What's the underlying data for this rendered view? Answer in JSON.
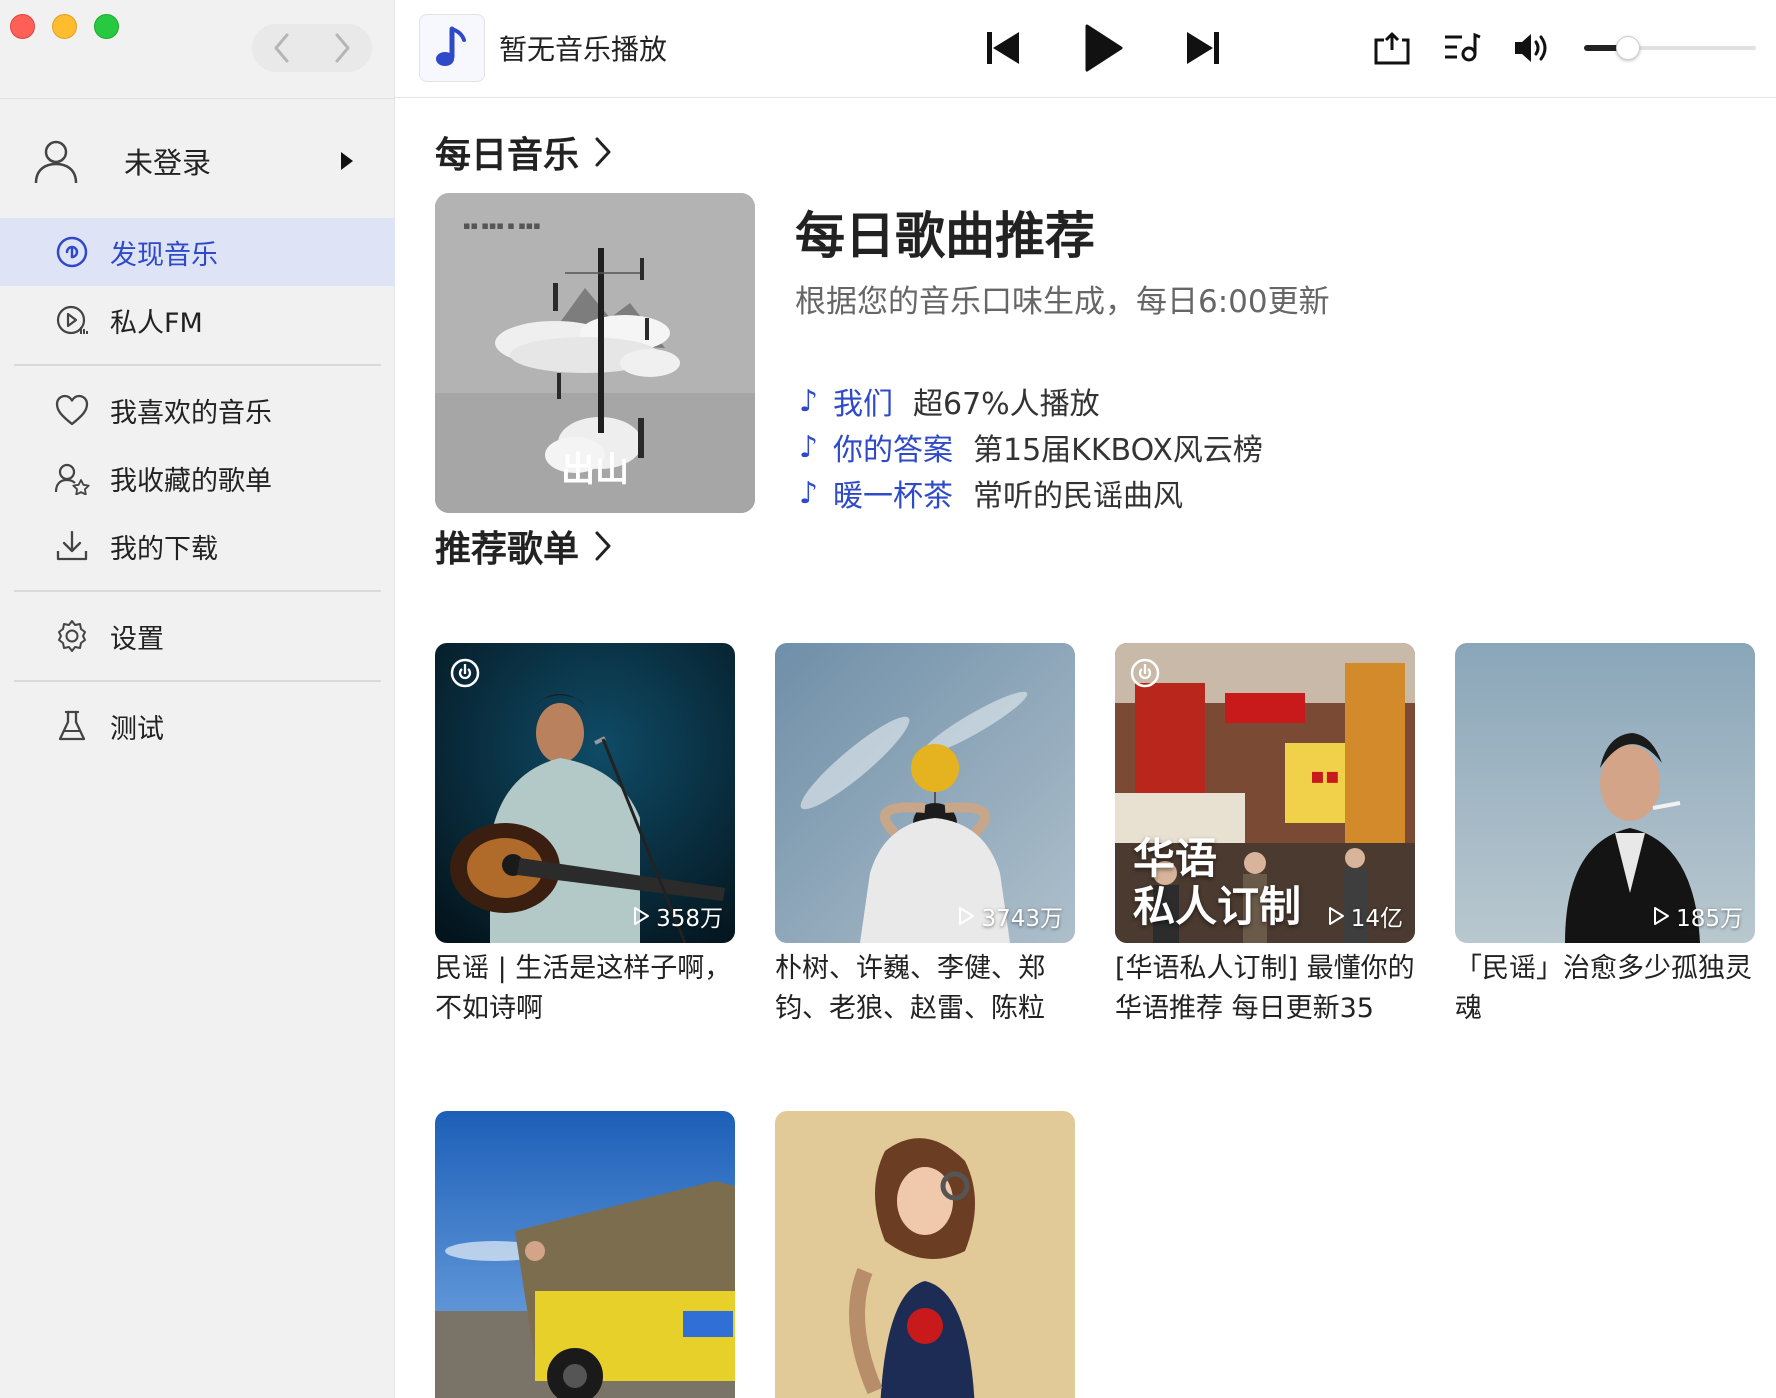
{
  "window": {
    "now_playing": "暂无音乐播放"
  },
  "sidebar": {
    "user": {
      "name": "未登录"
    },
    "items": [
      {
        "label": "发现音乐",
        "icon": "discover-music-icon",
        "active": true
      },
      {
        "label": "私人FM",
        "icon": "radio-fm-icon",
        "active": false
      },
      {
        "label": "我喜欢的音乐",
        "icon": "heart-icon",
        "active": false
      },
      {
        "label": "我收藏的歌单",
        "icon": "collected-playlists-icon",
        "active": false
      },
      {
        "label": "我的下载",
        "icon": "download-icon",
        "active": false
      },
      {
        "label": "设置",
        "icon": "gear-icon",
        "active": false
      },
      {
        "label": "测试",
        "icon": "flask-icon",
        "active": false
      }
    ]
  },
  "player": {
    "volume": 0.25
  },
  "daily": {
    "section_title": "每日音乐",
    "cover_label": "出山",
    "title": "每日歌曲推荐",
    "description": "根据您的音乐口味生成，每日6:00更新",
    "songs": [
      {
        "name": "我们",
        "tag": "超67%人播放"
      },
      {
        "name": "你的答案",
        "tag": "第15届KKBOX风云榜"
      },
      {
        "name": "暖一杯茶",
        "tag": "常听的民谣曲风"
      }
    ]
  },
  "recommended": {
    "section_title": "推荐歌单",
    "playlists": [
      {
        "title": "民谣 | 生活是这样子啊，不如诗啊",
        "play_count": "358万"
      },
      {
        "title": "朴树、许巍、李健、郑钧、老狼、赵雷、陈粒",
        "play_count": "3743万"
      },
      {
        "title": "[华语私人订制] 最懂你的华语推荐 每日更新35",
        "play_count": "14亿",
        "overlay": "华语\n私人订制"
      },
      {
        "title": "「民谣」治愈多少孤独灵魂",
        "play_count": "185万"
      },
      {
        "title": "",
        "play_count": ""
      },
      {
        "title": "",
        "play_count": ""
      }
    ]
  }
}
